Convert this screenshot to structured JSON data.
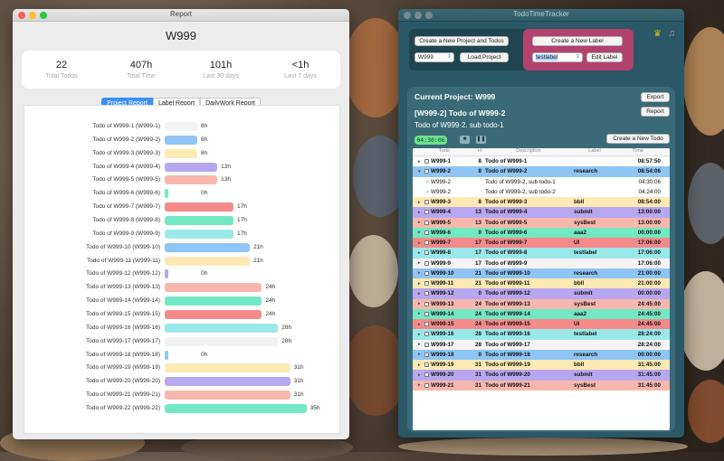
{
  "report": {
    "window_title": "Report",
    "project": "W999",
    "stats": [
      {
        "value": "22",
        "label": "Total Todos"
      },
      {
        "value": "407h",
        "label": "Total Time"
      },
      {
        "value": "101h",
        "label": "Last 30 days"
      },
      {
        "value": "<1h",
        "label": "Last 7 days"
      }
    ],
    "tabs": [
      "Project Report",
      "Label Report",
      "DailyWork Report"
    ],
    "active_tab": 0
  },
  "chart_data": {
    "type": "bar",
    "orientation": "horizontal",
    "categories": [
      "Todo of W999-1 (W999-1)",
      "Todo of W999-2 (W999-2)",
      "Todo of W999-3 (W999-3)",
      "Todo of W999-4 (W999-4)",
      "Todo of W999-5 (W999-5)",
      "Todo of W999-6 (W999-6)",
      "Todo of W999-7 (W999-7)",
      "Todo of W999-8 (W999-8)",
      "Todo of W999-9 (W999-9)",
      "Todo of W999-10 (W999-10)",
      "Todo of W999-11 (W999-11)",
      "Todo of W999-12 (W999-12)",
      "Todo of W999-13 (W999-13)",
      "Todo of W999-14 (W999-14)",
      "Todo of W999-15 (W999-15)",
      "Todo of W999-16 (W999-16)",
      "Todo of W999-17 (W999-17)",
      "Todo of W999-18 (W999-18)",
      "Todo of W999-19 (W999-19)",
      "Todo of W999-20 (W999-20)",
      "Todo of W999-21 (W999-21)",
      "Todo of W999-22 (W999-22)"
    ],
    "values": [
      8,
      8,
      8,
      13,
      13,
      0,
      17,
      17,
      17,
      21,
      21,
      0,
      24,
      24,
      24,
      28,
      28,
      0,
      31,
      31,
      31,
      35
    ],
    "value_labels": [
      "8h",
      "8h",
      "8h",
      "13h",
      "13h",
      "0h",
      "17h",
      "17h",
      "17h",
      "21h",
      "21h",
      "0h",
      "24h",
      "24h",
      "24h",
      "28h",
      "28h",
      "0h",
      "31h",
      "31h",
      "31h",
      "35h"
    ],
    "colors": [
      "#f2f2f2",
      "#8ec5f5",
      "#fde9b3",
      "#b7a7f0",
      "#f8b7ad",
      "#72e8c4",
      "#f58a8a",
      "#72e8c4",
      "#9ae8ea",
      "#8ec5f5",
      "#fde9b3",
      "#b7a7f0",
      "#f8b7ad",
      "#72e8c4",
      "#f58a8a",
      "#9ae8ea",
      "#f2f2f2",
      "#8ec5f5",
      "#fde9b3",
      "#b7a7f0",
      "#f8b7ad",
      "#72e8c4"
    ],
    "xlim": [
      0,
      38
    ]
  },
  "tracker": {
    "window_title": "TodoTimeTracker",
    "create_project_label": "Create a New Project and Todos",
    "project_select": "W999",
    "load_project_label": "Load Project",
    "create_label_label": "Create a New Label",
    "label_select": "testlabel",
    "edit_label_label": "Edit Label",
    "current_project": "Current Project: W999",
    "export_label": "Export",
    "report_label": "Report",
    "todo_title": "[W999-2] Todo of W999-2",
    "todo_sub": "Todo of W999-2. sub todo-1",
    "timer": "04:30:06",
    "create_todo_label": "Create a New Todo",
    "columns": [
      "Todo",
      "H",
      "Description",
      "Label",
      "Time"
    ],
    "rows": [
      {
        "id": "W999-1",
        "h": "8",
        "desc": "Todo of W999-1",
        "label": "",
        "time": "08:57:50",
        "color": "#ffffff",
        "tri": "▸"
      },
      {
        "id": "W999-2",
        "h": "8",
        "desc": "Todo of W999-2",
        "label": "research",
        "time": "08:54:06",
        "color": "#8ec5f5",
        "tri": "▾"
      },
      {
        "id": "W999-2",
        "h": "",
        "desc": "Todo of W999-2, sub todo-1",
        "label": "",
        "time": "04:30:06",
        "color": "#ffffff",
        "sub": true
      },
      {
        "id": "W999-2",
        "h": "",
        "desc": "Todo of W999-2, sub todo-2",
        "label": "",
        "time": "04:24:00",
        "color": "#ffffff",
        "sub": true
      },
      {
        "id": "W999-3",
        "h": "8",
        "desc": "Todo of W999-3",
        "label": "bbll",
        "time": "08:54:00",
        "color": "#fde9b3",
        "tri": "▸"
      },
      {
        "id": "W999-4",
        "h": "13",
        "desc": "Todo of W999-4",
        "label": "submit",
        "time": "13:00:00",
        "color": "#b7a7f0",
        "tri": "▸"
      },
      {
        "id": "W999-5",
        "h": "13",
        "desc": "Todo of W999-5",
        "label": "sysBest",
        "time": "13:00:00",
        "color": "#f8b7ad",
        "tri": "▸"
      },
      {
        "id": "W999-6",
        "h": "0",
        "desc": "Todo of W999-6",
        "label": "aaa2",
        "time": "00:00:00",
        "color": "#72e8c4",
        "tri": "▸"
      },
      {
        "id": "W999-7",
        "h": "17",
        "desc": "Todo of W999-7",
        "label": "UI",
        "time": "17:06:00",
        "color": "#f58a8a",
        "tri": "▸"
      },
      {
        "id": "W999-8",
        "h": "17",
        "desc": "Todo of W999-8",
        "label": "testlabel",
        "time": "17:06:00",
        "color": "#9ae8ea",
        "tri": "▸"
      },
      {
        "id": "W999-9",
        "h": "17",
        "desc": "Todo of W999-9",
        "label": "",
        "time": "17:06:00",
        "color": "#f4f4f4",
        "tri": "▸"
      },
      {
        "id": "W999-10",
        "h": "21",
        "desc": "Todo of W999-10",
        "label": "research",
        "time": "21:00:00",
        "color": "#8ec5f5",
        "tri": "▸"
      },
      {
        "id": "W999-11",
        "h": "21",
        "desc": "Todo of W999-11",
        "label": "bbll",
        "time": "21:00:00",
        "color": "#fde9b3",
        "tri": "▸"
      },
      {
        "id": "W999-12",
        "h": "0",
        "desc": "Todo of W999-12",
        "label": "submit",
        "time": "00:00:00",
        "color": "#b7a7f0",
        "tri": "▸"
      },
      {
        "id": "W999-13",
        "h": "24",
        "desc": "Todo of W999-13",
        "label": "sysBest",
        "time": "24:45:00",
        "color": "#f8b7ad",
        "tri": "▸"
      },
      {
        "id": "W999-14",
        "h": "24",
        "desc": "Todo of W999-14",
        "label": "aaa2",
        "time": "24:45:00",
        "color": "#72e8c4",
        "tri": "▸"
      },
      {
        "id": "W999-15",
        "h": "24",
        "desc": "Todo of W999-15",
        "label": "UI",
        "time": "24:45:00",
        "color": "#f58a8a",
        "tri": "▸"
      },
      {
        "id": "W999-16",
        "h": "28",
        "desc": "Todo of W999-16",
        "label": "testlabel",
        "time": "28:24:00",
        "color": "#9ae8ea",
        "tri": "▸"
      },
      {
        "id": "W999-17",
        "h": "28",
        "desc": "Todo of W999-17",
        "label": "",
        "time": "28:24:00",
        "color": "#f4f4f4",
        "tri": "▸"
      },
      {
        "id": "W999-18",
        "h": "0",
        "desc": "Todo of W999-18",
        "label": "research",
        "time": "00:00:00",
        "color": "#8ec5f5",
        "tri": "▸"
      },
      {
        "id": "W999-19",
        "h": "31",
        "desc": "Todo of W999-19",
        "label": "bbll",
        "time": "31:45:00",
        "color": "#fde9b3",
        "tri": "▸"
      },
      {
        "id": "W999-20",
        "h": "31",
        "desc": "Todo of W999-20",
        "label": "submit",
        "time": "31:45:00",
        "color": "#b7a7f0",
        "tri": "▸"
      },
      {
        "id": "W999-21",
        "h": "31",
        "desc": "Todo of W999-21",
        "label": "sysBest",
        "time": "31:45:00",
        "color": "#f8b7ad",
        "tri": "▸"
      }
    ]
  }
}
